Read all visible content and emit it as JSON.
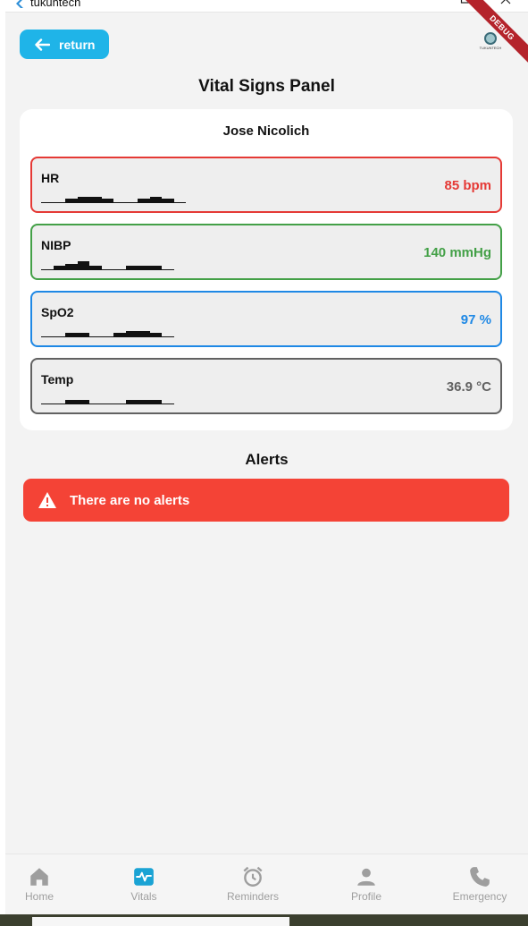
{
  "window": {
    "title": "tukuntech",
    "debug_label": "DEBUG",
    "logo_text": "TUKUNTECH"
  },
  "header": {
    "return_label": "return",
    "page_title": "Vital Signs Panel"
  },
  "patient": {
    "name": "Jose Nicolich"
  },
  "vitals": [
    {
      "name": "HR",
      "value": "85 bpm",
      "color": "#e53935",
      "spark": [
        1,
        1,
        2,
        3,
        3,
        2,
        1,
        1,
        2,
        3,
        2,
        1
      ]
    },
    {
      "name": "NIBP",
      "value": "140 mmHg",
      "color": "#43a047",
      "spark": [
        1,
        2,
        3,
        4,
        2,
        1,
        1,
        2,
        2,
        2,
        1
      ]
    },
    {
      "name": "SpO2",
      "value": "97 %",
      "color": "#1e88e5",
      "spark": [
        1,
        1,
        2,
        2,
        1,
        1,
        2,
        3,
        3,
        2,
        1
      ]
    },
    {
      "name": "Temp",
      "value": "36.9 °C",
      "color": "#616161",
      "spark": [
        1,
        1,
        2,
        2,
        1,
        1,
        1,
        2,
        2,
        2,
        1
      ]
    }
  ],
  "alerts": {
    "title": "Alerts",
    "message": "There are no alerts"
  },
  "nav": {
    "items": [
      {
        "label": "Home",
        "icon": "home-icon"
      },
      {
        "label": "Vitals",
        "icon": "vitals-icon"
      },
      {
        "label": "Reminders",
        "icon": "alarm-clock-icon"
      },
      {
        "label": "Profile",
        "icon": "person-icon"
      },
      {
        "label": "Emergency",
        "icon": "phone-icon"
      }
    ],
    "active": "Vitals"
  },
  "colors": {
    "accent": "#1fb4e8",
    "alert": "#f44336",
    "background": "#f3f3f3"
  }
}
